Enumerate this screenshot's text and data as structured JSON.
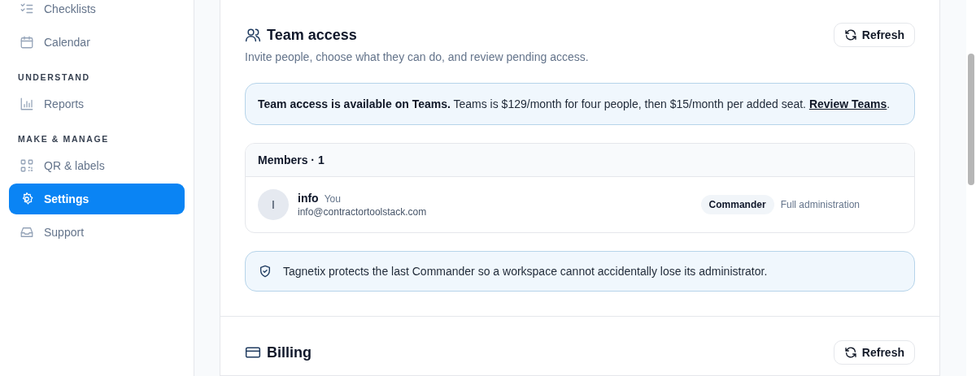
{
  "sidebar": {
    "groups": [
      {
        "items": [
          {
            "label": "Checklists",
            "selected": false
          },
          {
            "label": "Calendar",
            "selected": false
          }
        ]
      },
      {
        "heading": "UNDERSTAND",
        "items": [
          {
            "label": "Reports",
            "selected": false
          }
        ]
      },
      {
        "heading": "MAKE & MANAGE",
        "items": [
          {
            "label": "QR & labels",
            "selected": false
          },
          {
            "label": "Settings",
            "selected": true
          },
          {
            "label": "Support",
            "selected": false
          }
        ]
      }
    ]
  },
  "team_access": {
    "title": "Team access",
    "refresh_button": "Refresh",
    "description": "Invite people, choose what they can do, and review pending access.",
    "plan_notice": {
      "bold": "Team access is available on Teams.",
      "text": "Teams is $129/month for four people, then $15/month per added seat.",
      "link": "Review Teams",
      "after": "."
    },
    "members": {
      "heading": "Members · 1",
      "rows": [
        {
          "initial": "I",
          "name": "info",
          "tag": "You",
          "email": "info@contractortoolstack.com",
          "role": "Commander",
          "role_description": "Full administration"
        }
      ]
    },
    "protection_notice": "Tagnetix protects the last Commander so a workspace cannot accidentally lose its administrator."
  },
  "billing": {
    "title": "Billing",
    "refresh_button": "Refresh"
  }
}
